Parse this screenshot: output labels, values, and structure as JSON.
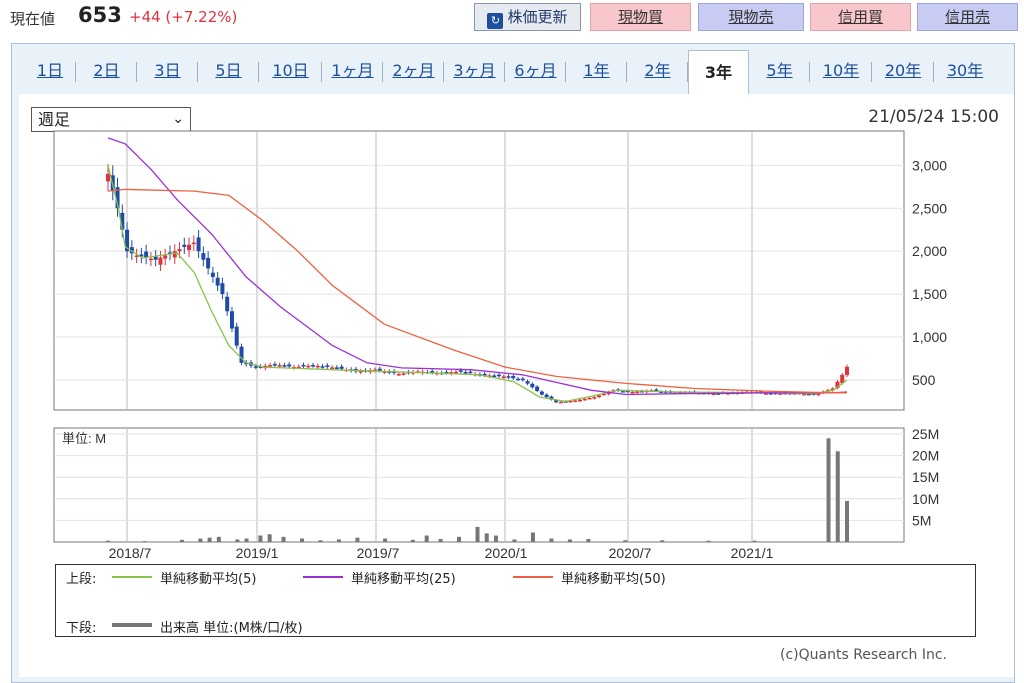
{
  "header": {
    "price_label": "現在値",
    "price_value": "653",
    "price_change": "+44 (+7.22%)",
    "refresh_icon": "refresh-icon",
    "refresh_label": "株価更新",
    "buy_label": "現物買",
    "sell_label": "現物売",
    "margin_buy_label": "信用買",
    "margin_sell_label": "信用売"
  },
  "tabs": [
    "1日",
    "2日",
    "3日",
    "5日",
    "10日",
    "1ヶ月",
    "2ヶ月",
    "3ヶ月",
    "6ヶ月",
    "1年",
    "2年",
    "3年",
    "5年",
    "10年",
    "20年",
    "30年"
  ],
  "active_tab": "3年",
  "period_select": "週足",
  "timestamp": "21/05/24 15:00",
  "legend": {
    "upper_label": "上段:",
    "lower_label": "下段:",
    "ma5": "単純移動平均(5)",
    "ma25": "単純移動平均(25)",
    "ma50": "単純移動平均(50)",
    "volume": "出来高 単位:(M株/口/枚)"
  },
  "copyright": "(c)Quants Research Inc.",
  "colors": {
    "up": "#e0323c",
    "down": "#1f4aa8",
    "ma5": "#8bc34a",
    "ma25": "#9b30d9",
    "ma50": "#f06040",
    "volume": "#777777",
    "accent_link": "#1c4f9d"
  },
  "chart_data": [
    {
      "type": "candlestick",
      "title": "",
      "x_tick_labels": [
        "2018/7",
        "2019/1",
        "2019/7",
        "2020/1",
        "2020/7",
        "2021/1"
      ],
      "y_tick_labels": [
        "3,000",
        "2,500",
        "2,000",
        "1,500",
        "1,000",
        "500"
      ],
      "ylim": [
        150,
        3400
      ],
      "grid": true,
      "weekly_close_approx": [
        [
          "2018-06-04",
          2900
        ],
        [
          "2018-06-18",
          2500
        ],
        [
          "2018-07-02",
          2000
        ],
        [
          "2018-07-16",
          1950
        ],
        [
          "2018-08-13",
          1900
        ],
        [
          "2018-09-10",
          2000
        ],
        [
          "2018-10-08",
          2100
        ],
        [
          "2018-10-29",
          1800
        ],
        [
          "2018-11-19",
          1500
        ],
        [
          "2018-12-03",
          1100
        ],
        [
          "2018-12-17",
          700
        ],
        [
          "2019-01-07",
          650
        ],
        [
          "2019-02-04",
          680
        ],
        [
          "2019-03-04",
          650
        ],
        [
          "2019-04-01",
          670
        ],
        [
          "2019-05-06",
          640
        ],
        [
          "2019-06-03",
          600
        ],
        [
          "2019-07-01",
          620
        ],
        [
          "2019-08-05",
          570
        ],
        [
          "2019-09-02",
          600
        ],
        [
          "2019-10-07",
          580
        ],
        [
          "2019-11-04",
          600
        ],
        [
          "2019-12-02",
          560
        ],
        [
          "2020-01-06",
          540
        ],
        [
          "2020-02-03",
          500
        ],
        [
          "2020-03-02",
          330
        ],
        [
          "2020-03-23",
          240
        ],
        [
          "2020-04-20",
          260
        ],
        [
          "2020-05-18",
          300
        ],
        [
          "2020-06-15",
          380
        ],
        [
          "2020-07-13",
          360
        ],
        [
          "2020-08-10",
          380
        ],
        [
          "2020-09-07",
          350
        ],
        [
          "2020-10-05",
          360
        ],
        [
          "2020-11-02",
          340
        ],
        [
          "2020-12-07",
          350
        ],
        [
          "2021-01-04",
          360
        ],
        [
          "2021-02-01",
          340
        ],
        [
          "2021-03-01",
          350
        ],
        [
          "2021-04-05",
          330
        ],
        [
          "2021-05-03",
          400
        ],
        [
          "2021-05-17",
          560
        ],
        [
          "2021-05-24",
          653
        ]
      ],
      "ma_series": [
        {
          "name": "単純移動平均(5)",
          "color": "#8bc34a",
          "values": [
            [
              0,
              3000
            ],
            [
              6,
              2500
            ],
            [
              10,
              2050
            ],
            [
              20,
              1920
            ],
            [
              40,
              1980
            ],
            [
              50,
              1750
            ],
            [
              60,
              1300
            ],
            [
              70,
              900
            ],
            [
              80,
              700
            ],
            [
              90,
              650
            ],
            [
              130,
              620
            ],
            [
              190,
              580
            ],
            [
              215,
              560
            ],
            [
              235,
              480
            ],
            [
              250,
              300
            ],
            [
              265,
              250
            ],
            [
              280,
              310
            ],
            [
              295,
              380
            ],
            [
              330,
              360
            ],
            [
              380,
              350
            ],
            [
              410,
              340
            ],
            [
              420,
              380
            ],
            [
              428,
              500
            ]
          ]
        },
        {
          "name": "単純移動平均(25)",
          "color": "#9b30d9",
          "values": [
            [
              0,
              3320
            ],
            [
              10,
              3250
            ],
            [
              25,
              2950
            ],
            [
              40,
              2600
            ],
            [
              60,
              2200
            ],
            [
              80,
              1700
            ],
            [
              100,
              1350
            ],
            [
              130,
              900
            ],
            [
              150,
              700
            ],
            [
              170,
              640
            ],
            [
              210,
              620
            ],
            [
              240,
              560
            ],
            [
              260,
              470
            ],
            [
              280,
              380
            ],
            [
              300,
              330
            ],
            [
              330,
              340
            ],
            [
              380,
              350
            ],
            [
              420,
              350
            ],
            [
              428,
              360
            ]
          ]
        },
        {
          "name": "単純移動平均(50)",
          "color": "#f06040",
          "values": [
            [
              0,
              2700
            ],
            [
              10,
              2720
            ],
            [
              50,
              2700
            ],
            [
              70,
              2650
            ],
            [
              90,
              2350
            ],
            [
              110,
              2000
            ],
            [
              130,
              1600
            ],
            [
              160,
              1150
            ],
            [
              200,
              850
            ],
            [
              230,
              650
            ],
            [
              260,
              540
            ],
            [
              300,
              460
            ],
            [
              340,
              400
            ],
            [
              380,
              370
            ],
            [
              420,
              350
            ],
            [
              428,
              350
            ]
          ]
        }
      ]
    },
    {
      "type": "bar",
      "title": "",
      "unit_label": "単位: M",
      "y_tick_labels": [
        "25M",
        "20M",
        "15M",
        "10M",
        "5M"
      ],
      "ylim": [
        0,
        25
      ],
      "series_name": "出来高",
      "values_M": [
        [
          0,
          0.3
        ],
        [
          40,
          0.2
        ],
        [
          80,
          0.5
        ],
        [
          100,
          0.8
        ],
        [
          110,
          1.0
        ],
        [
          120,
          1.2
        ],
        [
          140,
          0.6
        ],
        [
          150,
          0.8
        ],
        [
          165,
          1.5
        ],
        [
          175,
          1.8
        ],
        [
          190,
          1.2
        ],
        [
          210,
          0.8
        ],
        [
          230,
          0.4
        ],
        [
          250,
          0.6
        ],
        [
          270,
          1.0
        ],
        [
          300,
          0.8
        ],
        [
          330,
          0.5
        ],
        [
          345,
          1.5
        ],
        [
          360,
          0.7
        ],
        [
          380,
          1.2
        ],
        [
          400,
          3.5
        ],
        [
          410,
          2.0
        ],
        [
          420,
          1.5
        ],
        [
          440,
          0.6
        ],
        [
          460,
          2.2
        ],
        [
          480,
          0.8
        ],
        [
          500,
          0.6
        ],
        [
          520,
          0.7
        ],
        [
          560,
          0.4
        ],
        [
          600,
          0.4
        ],
        [
          650,
          0.3
        ],
        [
          700,
          0.3
        ],
        [
          780,
          24.0
        ],
        [
          790,
          21.0
        ],
        [
          800,
          9.5
        ]
      ]
    }
  ]
}
